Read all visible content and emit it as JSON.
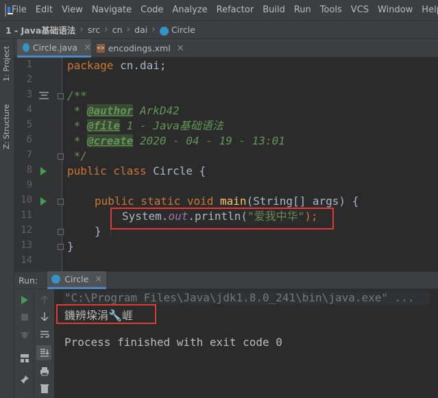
{
  "menu": [
    "File",
    "Edit",
    "View",
    "Navigate",
    "Code",
    "Analyze",
    "Refactor",
    "Build",
    "Run",
    "Tools",
    "VCS",
    "Window",
    "Help"
  ],
  "breadcrumb": {
    "project": "1 - Java基础语法",
    "path": [
      "src",
      "cn",
      "dai"
    ],
    "file": "Circle"
  },
  "tool_windows": {
    "project": "1: Project",
    "structure": "Z: Structure"
  },
  "tabs": [
    {
      "label": "Circle.java",
      "close": "×",
      "active": true
    },
    {
      "label": "encodings.xml",
      "close": "×",
      "active": false
    }
  ],
  "editor": {
    "line_numbers": [
      "1",
      "2",
      "3",
      "4",
      "5",
      "6",
      "7",
      "8",
      "9",
      "10",
      "11",
      "12",
      "13",
      "14"
    ],
    "l1": {
      "kw": "package",
      "rest": " cn.dai;"
    },
    "l3": "/**",
    "l4": {
      "star": " * ",
      "tag": "@author",
      "text": " ArkD42"
    },
    "l5": {
      "star": " * ",
      "tag": "@file",
      "text": " 1 - Java基础语法"
    },
    "l6": {
      "star": " * ",
      "tag": "@create",
      "text": " 2020 - 04 - 19 - 13:01"
    },
    "l7": " */",
    "l8": {
      "kw": "public class",
      "rest": " Circle {"
    },
    "l10": {
      "kw": "public static void",
      "fn": "main",
      "rest": "(String[] args) {"
    },
    "l11": {
      "obj": "System.",
      "field": "out",
      "call": ".println(",
      "str": "\"爱我中华\"",
      "end": ");"
    },
    "l12": "}",
    "l13": "}"
  },
  "run": {
    "label": "Run:",
    "tab": "Circle",
    "tab_close": "×",
    "command": "\"C:\\Program Files\\Java\\jdk1.8.0_241\\bin\\java.exe\" ...",
    "output": "鐖辨垜涓🔧崕",
    "exit": "Process finished with exit code 0"
  },
  "colors": {
    "highlight": "#e53935",
    "run_green": "#499c54",
    "keyword": "#cc7832",
    "comment": "#629755",
    "string": "#6a8759",
    "method": "#ffc66d"
  }
}
